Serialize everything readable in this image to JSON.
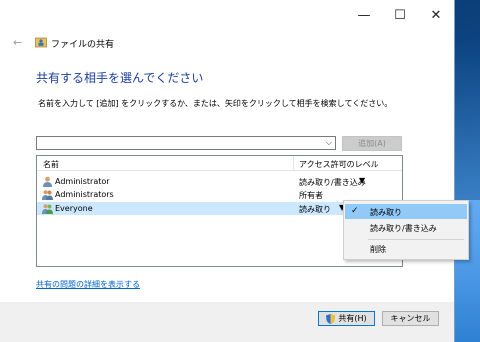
{
  "window": {
    "minimize_glyph": "—",
    "maximize_glyph": "☐",
    "close_glyph": "✕",
    "back_glyph": "←",
    "title": "ファイルの共有"
  },
  "main": {
    "heading": "共有する相手を選んでください",
    "instruction": "名前を入力して [追加] をクリックするか、または、矢印をクリックして相手を検索してください。",
    "combo_value": "",
    "combo_arrow": "⌵",
    "add_label": "追加(A)"
  },
  "list": {
    "col_name": "名前",
    "col_level": "アクセス許可のレベル",
    "rows": [
      {
        "name": "Administrator",
        "level": "読み取り/書き込み",
        "arrow": "▼"
      },
      {
        "name": "Administrators",
        "level": "所有者"
      },
      {
        "name": "Everyone",
        "level": "読み取り",
        "arrow": "▼"
      }
    ]
  },
  "menu": {
    "check": "✓",
    "items": [
      "読み取り",
      "読み取り/書き込み",
      "削除"
    ]
  },
  "footer": {
    "link": "共有の問題の詳細を表示する",
    "share_label": "共有(H)",
    "cancel_label": "キャンセル"
  },
  "colors": {
    "heading": "#1b3f9e",
    "link": "#0066cc",
    "selection": "#cce8ff",
    "menu_hot": "#91c9f7"
  }
}
